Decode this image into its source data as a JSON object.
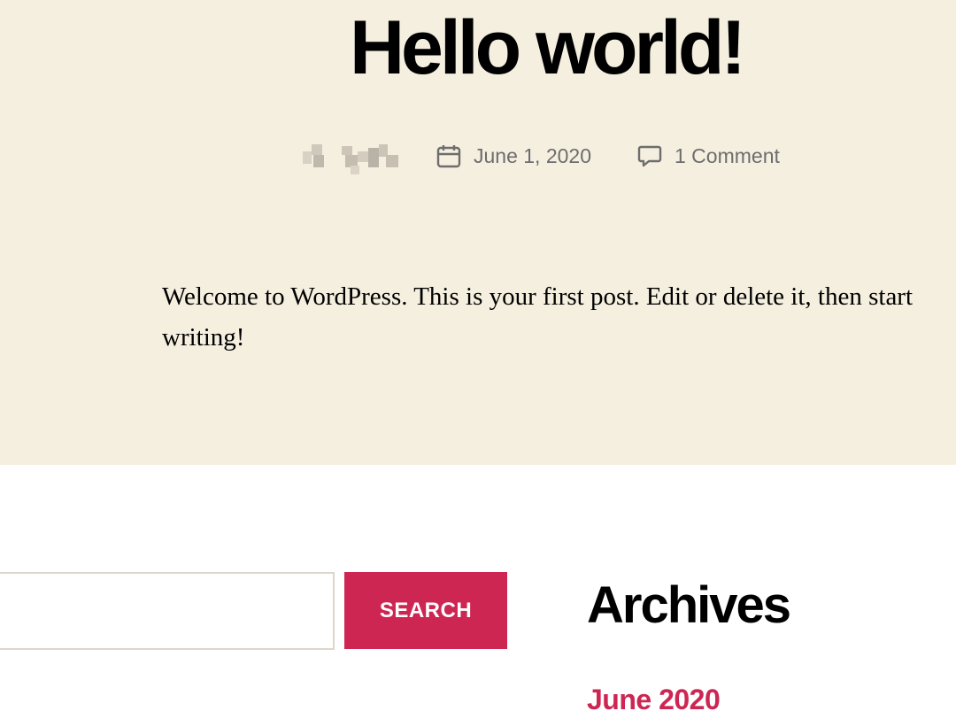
{
  "post": {
    "title": "Hello world!",
    "date": "June 1, 2020",
    "comments": "1 Comment",
    "content": "Welcome to WordPress. This is your first post. Edit or delete it, then start writing!"
  },
  "search": {
    "value": "",
    "placeholder": "",
    "button_label": "SEARCH"
  },
  "archives": {
    "title": "Archives",
    "items": [
      {
        "label": "June 2020"
      }
    ]
  },
  "colors": {
    "post_background": "#f5efe0",
    "accent": "#cd2653",
    "meta_text": "#6d6d6d"
  },
  "icons": {
    "author": "author-avatar-icon",
    "date": "calendar-icon",
    "comments": "comment-bubble-icon"
  }
}
